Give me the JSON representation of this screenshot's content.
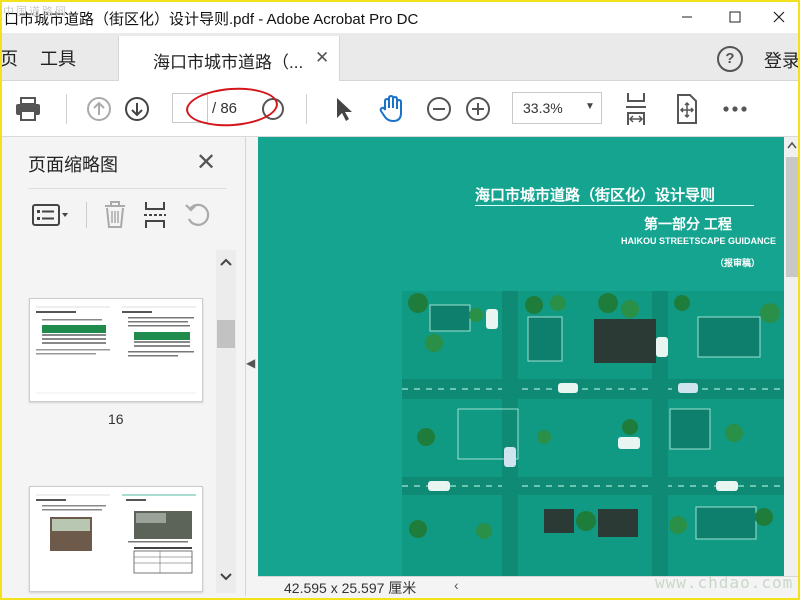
{
  "window": {
    "title": "口市城市道路（街区化）设计导则.pdf - Adobe Acrobat Pro DC",
    "watermark_top": "中国道路网"
  },
  "tabs": {
    "home_partial": "页",
    "tools": "工具",
    "document": "海口市城市道路（...",
    "signin": "登录",
    "help": "?"
  },
  "toolbar": {
    "current_page": "",
    "total_pages": "/ 86",
    "zoom": "33.3%"
  },
  "panel": {
    "title": "页面缩略图",
    "thumbnails": [
      {
        "label": "16"
      },
      {
        "label": ""
      }
    ]
  },
  "document": {
    "cover_title": "海口市城市道路（街区化）设计导则",
    "cover_subtitle": "第一部分   工程",
    "cover_english": "HAIKOU STREETSCAPE GUIDANCE",
    "cover_note": "（报审稿）",
    "page_color": "#14a490"
  },
  "status": {
    "dimensions": "42.595 x 25.597 厘米"
  },
  "watermark_bottom": "www.chdao.com",
  "colors": {
    "accent_blue": "#1a73c9",
    "annotation_red": "#d4161b",
    "frame_yellow": "#f3e11b"
  }
}
